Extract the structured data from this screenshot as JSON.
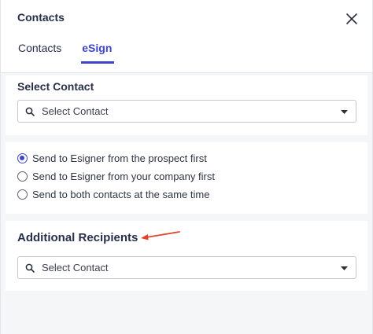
{
  "header": {
    "title": "Contacts",
    "close_icon": "close-icon",
    "tabs": [
      {
        "label": "Contacts",
        "active": false
      },
      {
        "label": "eSign",
        "active": true
      }
    ]
  },
  "select_contact": {
    "title": "Select Contact",
    "placeholder": "Select Contact"
  },
  "send_options": [
    {
      "label": "Send to Esigner from the prospect first",
      "checked": true
    },
    {
      "label": "Send to Esigner from your company first",
      "checked": false
    },
    {
      "label": "Send to both contacts at the same time",
      "checked": false
    }
  ],
  "additional_recipients": {
    "title": "Additional Recipients",
    "placeholder": "Select Contact"
  },
  "colors": {
    "accent": "#3d46c9",
    "annotation_arrow": "#e0432c"
  }
}
